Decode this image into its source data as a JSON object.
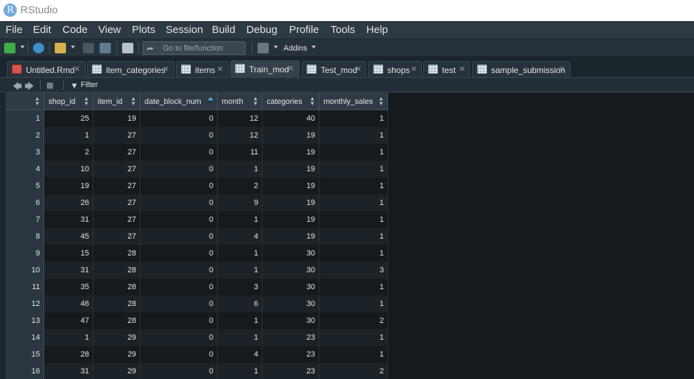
{
  "window": {
    "title": "RStudio"
  },
  "menu": [
    "File",
    "Edit",
    "Code",
    "View",
    "Plots",
    "Session",
    "Build",
    "Debug",
    "Profile",
    "Tools",
    "Help"
  ],
  "toolbar": {
    "goto_placeholder": "Go to file/function",
    "addins_label": "Addins"
  },
  "tabs": [
    {
      "label": "Untitled.Rmd",
      "icon": "rmd-file-icon"
    },
    {
      "label": "item_categories",
      "icon": "table-icon"
    },
    {
      "label": "items",
      "icon": "table-icon"
    },
    {
      "label": "Train_mod",
      "icon": "table-icon",
      "active": true
    },
    {
      "label": "Test_mod",
      "icon": "table-icon"
    },
    {
      "label": "shops",
      "icon": "table-icon"
    },
    {
      "label": "test",
      "icon": "table-icon"
    },
    {
      "label": "sample_submission",
      "icon": "table-icon"
    }
  ],
  "viewer": {
    "filter_label": "Filter"
  },
  "table": {
    "columns": [
      "shop_id",
      "item_id",
      "date_block_num",
      "month",
      "categories",
      "monthly_sales"
    ],
    "sorted_column": "date_block_num",
    "rows": [
      [
        1,
        25,
        19,
        0,
        12,
        40,
        1
      ],
      [
        2,
        1,
        27,
        0,
        12,
        19,
        1
      ],
      [
        3,
        2,
        27,
        0,
        11,
        19,
        1
      ],
      [
        4,
        10,
        27,
        0,
        1,
        19,
        1
      ],
      [
        5,
        19,
        27,
        0,
        2,
        19,
        1
      ],
      [
        6,
        26,
        27,
        0,
        9,
        19,
        1
      ],
      [
        7,
        31,
        27,
        0,
        1,
        19,
        1
      ],
      [
        8,
        45,
        27,
        0,
        4,
        19,
        1
      ],
      [
        9,
        15,
        28,
        0,
        1,
        30,
        1
      ],
      [
        10,
        31,
        28,
        0,
        1,
        30,
        3
      ],
      [
        11,
        35,
        28,
        0,
        3,
        30,
        1
      ],
      [
        12,
        46,
        28,
        0,
        6,
        30,
        1
      ],
      [
        13,
        47,
        28,
        0,
        1,
        30,
        2
      ],
      [
        14,
        1,
        29,
        0,
        1,
        23,
        1
      ],
      [
        15,
        28,
        29,
        0,
        4,
        23,
        1
      ],
      [
        16,
        31,
        29,
        0,
        1,
        23,
        2
      ]
    ]
  }
}
